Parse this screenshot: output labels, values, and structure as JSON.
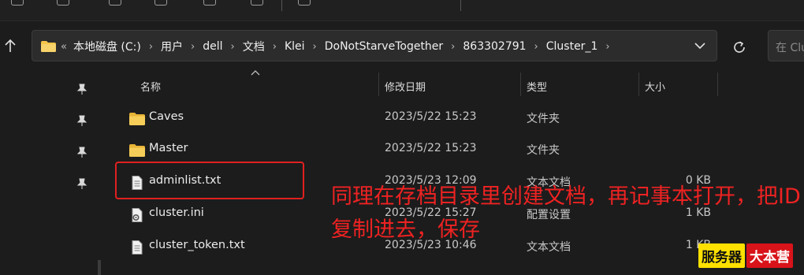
{
  "address_bar": {
    "lead": "«",
    "crumbs": [
      "本地磁盘 (C:)",
      "用户",
      "dell",
      "文档",
      "Klei",
      "DoNotStarveTogether",
      "863302791",
      "Cluster_1"
    ]
  },
  "search": {
    "placeholder": "在 Clu"
  },
  "columns": {
    "name": "名称",
    "modified": "修改日期",
    "type": "类型",
    "size": "大小"
  },
  "files": [
    {
      "name": "Caves",
      "modified": "2023/5/22 15:23",
      "type": "文件夹",
      "size": "",
      "icon": "folder-icon"
    },
    {
      "name": "Master",
      "modified": "2023/5/22 15:23",
      "type": "文件夹",
      "size": "",
      "icon": "folder-icon"
    },
    {
      "name": "adminlist.txt",
      "modified": "2023/5/23 12:09",
      "type": "文本文档",
      "size": "0 KB",
      "icon": "text-file-icon"
    },
    {
      "name": "cluster.ini",
      "modified": "2023/5/22 15:27",
      "type": "配置设置",
      "size": "1 KB",
      "icon": "config-file-icon"
    },
    {
      "name": "cluster_token.txt",
      "modified": "2023/5/23 10:46",
      "type": "文本文档",
      "size": "1 KB",
      "icon": "text-file-icon"
    }
  ],
  "annotation": "同理在存档目录里创建文档，再记事本打开，把ID复制进去，保存",
  "watermark": {
    "part1": "服务器",
    "part2": "大本营"
  },
  "colors": {
    "accent_red": "#e12020",
    "folder": "#f4c64b",
    "background": "#1c1c1c"
  }
}
